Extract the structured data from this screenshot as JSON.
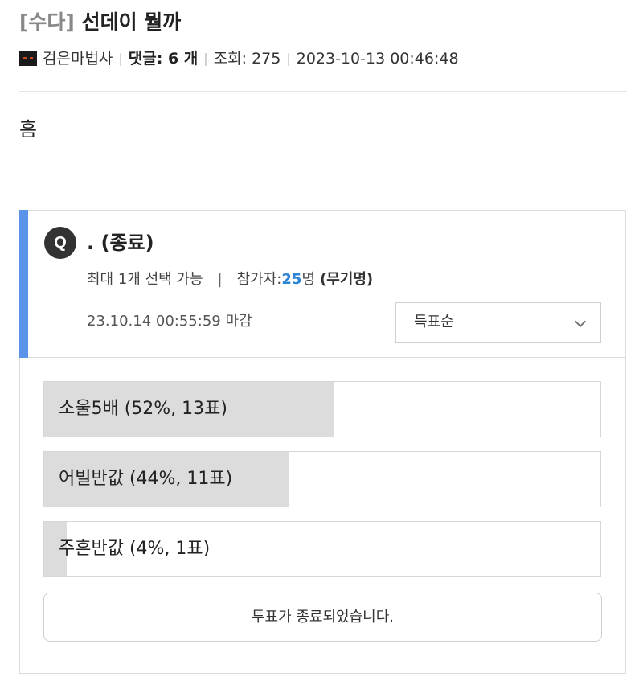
{
  "post": {
    "category": "[수다]",
    "title": "선데이 뭘까",
    "author": "검은마법사",
    "comments_label": "댓글: 6 개",
    "views_label": "조회: 275",
    "datetime": "2023-10-13 00:46:48",
    "body": "흠"
  },
  "poll": {
    "badge": "Q",
    "question": ". (종료)",
    "max_select": "최대 1개 선택 가능",
    "separator": "|",
    "participants_label": "참가자: ",
    "participants_count": "25",
    "participants_unit": "명",
    "anonymous": "(무기명)",
    "deadline": "23.10.14 00:55:59 마감",
    "sort_selected": "득표순",
    "options": [
      {
        "label": "소울5배 (52%, 13표)",
        "percent": 52
      },
      {
        "label": "어빌반값 (44%, 11표)",
        "percent": 44
      },
      {
        "label": "주흔반값 (4%, 1표)",
        "percent": 4
      }
    ],
    "status": "투표가 종료되었습니다."
  }
}
